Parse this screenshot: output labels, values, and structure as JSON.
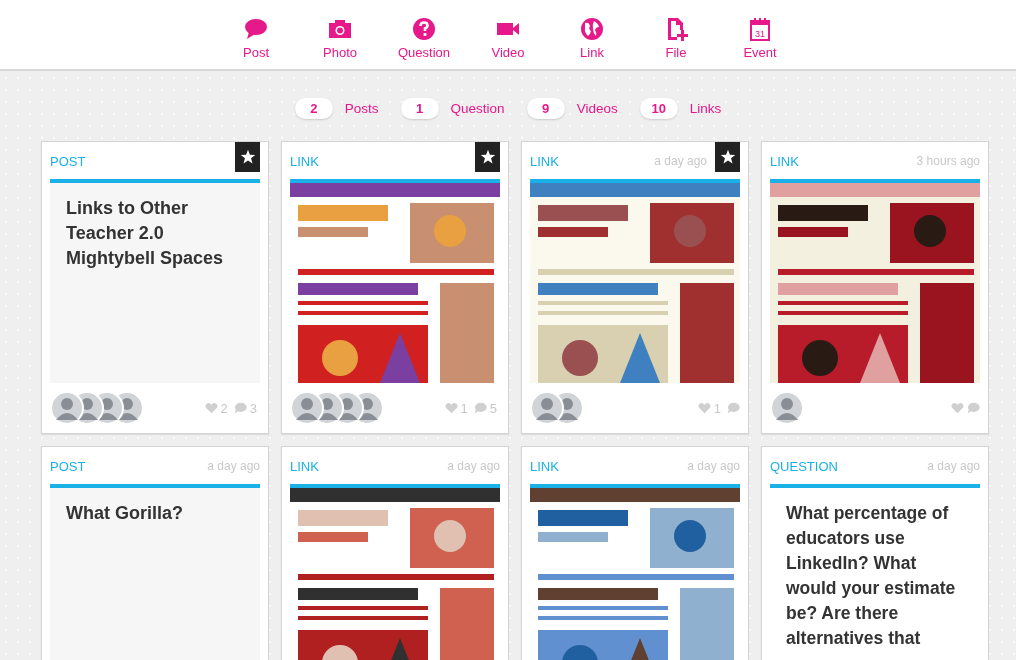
{
  "toolbar": [
    {
      "kind": "post",
      "label": "Post"
    },
    {
      "label": "Photo"
    },
    {
      "kind": "question",
      "label": "Question"
    },
    {
      "kind": "video",
      "label": "Video"
    },
    {
      "kind": "link",
      "label": "Link"
    },
    {
      "kind": "file",
      "label": "File"
    },
    {
      "kind": "event",
      "label": "Event",
      "badge": "31"
    }
  ],
  "counts": [
    {
      "count": "2",
      "label": "Posts"
    },
    {
      "count": "1",
      "label": "Question"
    },
    {
      "count": "9",
      "label": "Videos"
    },
    {
      "count": "10",
      "label": "Links"
    }
  ],
  "cards": [
    {
      "kind": "post",
      "type": "POST",
      "starred": true,
      "title": "Links to Other Teacher 2.0 Mightybell Spaces",
      "avatars": [
        {
          "kind": "person"
        },
        {
          "kind": "person"
        },
        {
          "kind": "person"
        },
        {
          "kind": "person"
        }
      ],
      "likes": "2",
      "comments": "3"
    },
    {
      "kind": "link",
      "type": "LINK",
      "starred": true,
      "preview": {
        "kind": "picture"
      },
      "avatars": [
        {
          "kind": "person"
        },
        {
          "kind": "person"
        },
        {
          "kind": "person"
        },
        {
          "kind": "person"
        }
      ],
      "likes": "1",
      "comments": "5"
    },
    {
      "kind": "link",
      "type": "LINK",
      "time": "a day ago",
      "starred": true,
      "preview": {
        "kind": "picture"
      },
      "avatars": [
        {
          "kind": "person"
        },
        {
          "kind": "person"
        }
      ],
      "likes": "1"
    },
    {
      "kind": "link",
      "type": "LINK",
      "time": "3 hours ago",
      "starred": false,
      "preview": {
        "kind": "picture"
      },
      "avatars": [
        {
          "kind": "person"
        }
      ]
    },
    {
      "kind": "post",
      "type": "POST",
      "time": "a day ago",
      "starred": false,
      "title": "What Gorilla?"
    },
    {
      "kind": "link",
      "type": "LINK",
      "time": "a day ago",
      "starred": false,
      "preview": {
        "kind": "picture"
      }
    },
    {
      "kind": "link",
      "type": "LINK",
      "time": "a day ago",
      "starred": false,
      "preview": {
        "kind": "picture"
      }
    },
    {
      "kind": "question",
      "type": "QUESTION",
      "time": "a day ago",
      "starred": false,
      "title": "What percentage of educators use LinkedIn? What would your estimate be? Are there alternatives that"
    }
  ]
}
